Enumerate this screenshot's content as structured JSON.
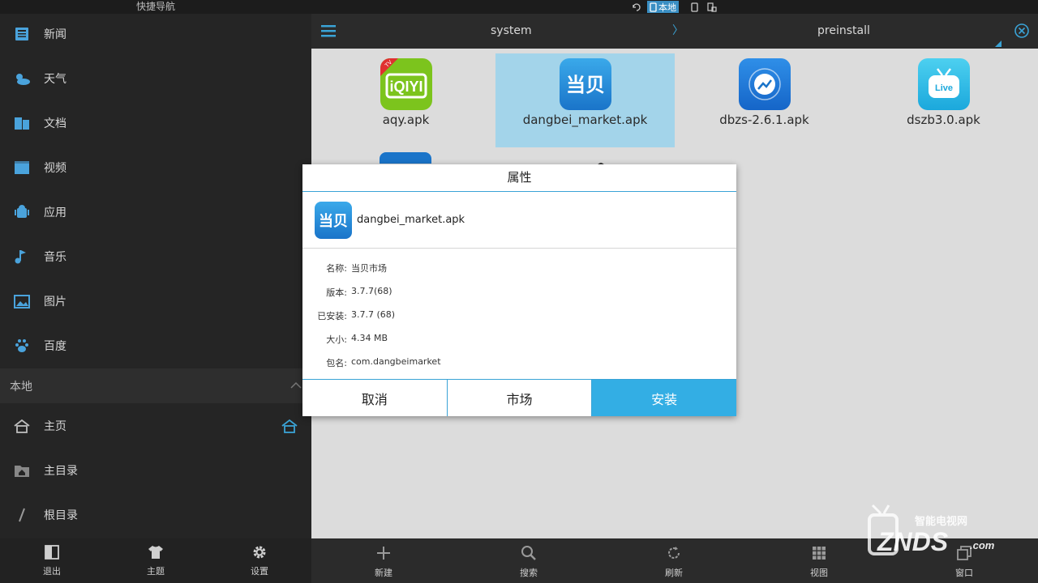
{
  "sidebar": {
    "title": "快捷导航",
    "items": [
      {
        "label": "新闻",
        "icon": "news-icon"
      },
      {
        "label": "天气",
        "icon": "weather-icon"
      },
      {
        "label": "文档",
        "icon": "document-icon"
      },
      {
        "label": "视频",
        "icon": "video-icon"
      },
      {
        "label": "应用",
        "icon": "app-icon"
      },
      {
        "label": "音乐",
        "icon": "music-icon"
      },
      {
        "label": "图片",
        "icon": "picture-icon"
      },
      {
        "label": "百度",
        "icon": "baidu-paw-icon"
      }
    ],
    "section": "本地",
    "local_items": [
      {
        "label": "主页",
        "icon": "home-icon"
      },
      {
        "label": "主目录",
        "icon": "folder-home-icon"
      },
      {
        "label": "根目录",
        "icon": "slash-icon"
      }
    ],
    "bottom": [
      {
        "label": "退出",
        "icon": "exit-icon"
      },
      {
        "label": "主题",
        "icon": "shirt-icon"
      },
      {
        "label": "设置",
        "icon": "gear-icon"
      }
    ]
  },
  "statusbar": {
    "local": "本地"
  },
  "topbar": {
    "crumb1": "system",
    "sep": "〉",
    "crumb2": "preinstall"
  },
  "files": [
    {
      "name": "aqy.apk",
      "selected": false
    },
    {
      "name": "dangbei_market.apk",
      "selected": true
    },
    {
      "name": "dbzs-2.6.1.apk",
      "selected": false
    },
    {
      "name": "dszb3.0.apk",
      "selected": false
    }
  ],
  "dialog": {
    "title": "属性",
    "filename": "dangbei_market.apk",
    "icon_text": "当贝",
    "props": [
      {
        "key": "名称:",
        "value": "当贝市场"
      },
      {
        "key": "版本:",
        "value": "3.7.7(68)"
      },
      {
        "key": "已安装:",
        "value": "3.7.7 (68)"
      },
      {
        "key": "大小:",
        "value": "4.34 MB"
      },
      {
        "key": "包名:",
        "value": "com.dangbeimarket"
      }
    ],
    "buttons": {
      "cancel": "取消",
      "market": "市场",
      "install": "安装"
    }
  },
  "bottombar": [
    {
      "label": "新建",
      "icon": "plus-icon"
    },
    {
      "label": "搜索",
      "icon": "search-icon"
    },
    {
      "label": "刷新",
      "icon": "refresh-icon"
    },
    {
      "label": "视图",
      "icon": "grid-icon"
    },
    {
      "label": "窗口",
      "icon": "window-icon"
    }
  ],
  "watermark": {
    "cn": "智能电视网",
    "brand": "ZNDS",
    "suffix": ".com"
  },
  "colors": {
    "accent": "#33aee4",
    "sidebar_icon": "#4aa3dc",
    "selected_tile": "#a3d4ea"
  }
}
